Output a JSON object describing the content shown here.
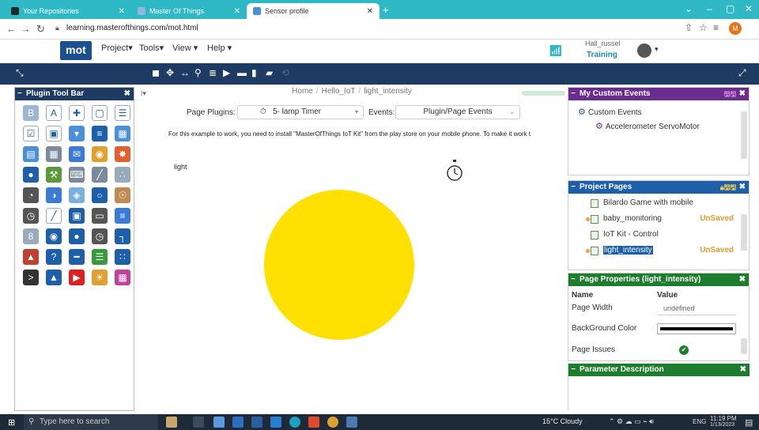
{
  "browser": {
    "tabs": [
      {
        "title": "Your Repositories",
        "icon": "github-icon",
        "color": "#24292e"
      },
      {
        "title": "Master Of Things",
        "icon": "mot-icon",
        "color": "#1d4f8c"
      },
      {
        "title": "Sensor profile",
        "icon": "profile-icon",
        "color": "#4a90d9"
      }
    ],
    "url": "learning.masterofthings.com/mot.html",
    "profile_initial": "M"
  },
  "app": {
    "logo": "mot",
    "menu": [
      "Project▾",
      "Tools▾",
      "View ▾",
      "Help ▾"
    ],
    "user_name": "Hall_russel",
    "training": "Training"
  },
  "plugin_toolbar": {
    "title": "Plugin Tool Bar",
    "icons": [
      {
        "name": "button-plugin-icon",
        "color": "#9bb7d4",
        "glyph": "B"
      },
      {
        "name": "text-plugin-icon",
        "color": "#ffffff",
        "glyph": "A"
      },
      {
        "name": "move-plugin-icon",
        "color": "#ffffff",
        "glyph": "✚"
      },
      {
        "name": "box-plugin-icon",
        "color": "#ffffff",
        "glyph": "▢"
      },
      {
        "name": "list-plugin-icon",
        "color": "#ffffff",
        "glyph": "☰"
      },
      {
        "name": "checkbox-plugin-icon",
        "color": "#ffffff",
        "glyph": "☑"
      },
      {
        "name": "radio-plugin-icon",
        "color": "#ffffff",
        "glyph": "▣"
      },
      {
        "name": "dropdown-plugin-icon",
        "color": "#4a90d9",
        "glyph": "▾"
      },
      {
        "name": "menu-plugin-icon",
        "color": "#1d5fa8",
        "glyph": "≡"
      },
      {
        "name": "table-plugin-icon",
        "color": "#4a90d9",
        "glyph": "▦"
      },
      {
        "name": "grid-plugin-icon",
        "color": "#4a90d9",
        "glyph": "▤"
      },
      {
        "name": "calendar-plugin-icon",
        "color": "#7a8a9a",
        "glyph": "▦"
      },
      {
        "name": "chat-plugin-icon",
        "color": "#3a7bd5",
        "glyph": "✉"
      },
      {
        "name": "google-plugin-icon",
        "color": "#e0a030",
        "glyph": "◉"
      },
      {
        "name": "puzzle-plugin-icon",
        "color": "#e06030",
        "glyph": "✸"
      },
      {
        "name": "location-plugin-icon",
        "color": "#1d5fa8",
        "glyph": "●"
      },
      {
        "name": "tools-plugin-icon",
        "color": "#5a9a3a",
        "glyph": "⚒"
      },
      {
        "name": "keyboard-plugin-icon",
        "color": "#7a8a9a",
        "glyph": "⌨"
      },
      {
        "name": "line-chart-plugin-icon",
        "color": "#7a8a9a",
        "glyph": "╱"
      },
      {
        "name": "scatter-plugin-icon",
        "color": "#9ab",
        "glyph": "∴"
      },
      {
        "name": "pie-chart-plugin-icon",
        "color": "#555555",
        "glyph": "◔"
      },
      {
        "name": "gauge-plugin-icon",
        "color": "#3a7bd5",
        "glyph": "◑"
      },
      {
        "name": "cube-plugin-icon",
        "color": "#7ab0e0",
        "glyph": "◈"
      },
      {
        "name": "circle-plugin-icon",
        "color": "#1d5fa8",
        "glyph": "○"
      },
      {
        "name": "globe-plugin-icon",
        "color": "#c08a50",
        "glyph": "☉"
      },
      {
        "name": "dial-plugin-icon",
        "color": "#555555",
        "glyph": "◷"
      },
      {
        "name": "line-plugin-icon",
        "color": "#ffffff",
        "glyph": "╱"
      },
      {
        "name": "image-plugin-icon",
        "color": "#1d5fa8",
        "glyph": "▣"
      },
      {
        "name": "timer-box-plugin-icon",
        "color": "#555555",
        "glyph": "▭"
      },
      {
        "name": "slider-plugin-icon",
        "color": "#3a7bd5",
        "glyph": "≡"
      },
      {
        "name": "digit-plugin-icon",
        "color": "#9ab",
        "glyph": "8"
      },
      {
        "name": "camera-plugin-icon",
        "color": "#1d5fa8",
        "glyph": "◉"
      },
      {
        "name": "record-plugin-icon",
        "color": "#1d5fa8",
        "glyph": "●"
      },
      {
        "name": "stopwatch-plugin-icon",
        "color": "#555555",
        "glyph": "◷"
      },
      {
        "name": "step-plugin-icon",
        "color": "#1d5fa8",
        "glyph": "┐"
      },
      {
        "name": "level-plugin-icon",
        "color": "#c04030",
        "glyph": "▲"
      },
      {
        "name": "help-plugin-icon",
        "color": "#1d5fa8",
        "glyph": "?"
      },
      {
        "name": "bar-plugin-icon",
        "color": "#1d5fa8",
        "glyph": "━"
      },
      {
        "name": "database-plugin-icon",
        "color": "#3a9a3a",
        "glyph": "☰"
      },
      {
        "name": "dots-chart-plugin-icon",
        "color": "#1d5fa8",
        "glyph": "∷"
      },
      {
        "name": "terminal-plugin-icon",
        "color": "#333333",
        "glyph": ">"
      },
      {
        "name": "upload-plugin-icon",
        "color": "#1d5fa8",
        "glyph": "▲"
      },
      {
        "name": "youtube-plugin-icon",
        "color": "#e02020",
        "glyph": "▶"
      },
      {
        "name": "weather-plugin-icon",
        "color": "#e0a030",
        "glyph": "☀"
      },
      {
        "name": "schedule-plugin-icon",
        "color": "#c040a0",
        "glyph": "▦"
      }
    ]
  },
  "center": {
    "breadcrumb": [
      "Home",
      "Hello_IoT",
      "light_intensity"
    ],
    "page_plugins_label": "Page Plugins:",
    "page_plugin_value": "5- lamp Timer",
    "events_label": "Events:",
    "events_value": "Plugin/Page Events",
    "notice": "For this example to work, you need to install \"MasterOfThings IoT Kit\" from the play store on your mobile phone. To make it work t",
    "light_label": "light",
    "lamp_color": "#ffe000"
  },
  "custom_events": {
    "title": "My Custom Events",
    "root": "Custom Events",
    "child": "Accelerometer ServoMotor"
  },
  "project_pages": {
    "title": "Project Pages",
    "pages": [
      {
        "name": "Bilardo Game with mobile",
        "status": "",
        "dot": false,
        "selected": false
      },
      {
        "name": "baby_monitoring",
        "status": "UnSaved",
        "dot": true,
        "selected": false
      },
      {
        "name": "IoT Kit - Control",
        "status": "",
        "dot": false,
        "selected": false
      },
      {
        "name": "light_intensity",
        "status": "UnSaved",
        "dot": true,
        "selected": true
      }
    ]
  },
  "page_properties": {
    "title": "Page Properties (light_intensity)",
    "col_name": "Name",
    "col_value": "Value",
    "rows": {
      "width_label": "Page Width",
      "width_value": "undefined",
      "bg_label": "BackGround Color",
      "issues_label": "Page Issues"
    }
  },
  "parameter_description": {
    "title": "Parameter Description"
  },
  "taskbar": {
    "search_placeholder": "Type here to search",
    "weather": "15°C  Cloudy",
    "lang": "ENG",
    "time": "11:19 PM",
    "date": "1/13/2023"
  }
}
